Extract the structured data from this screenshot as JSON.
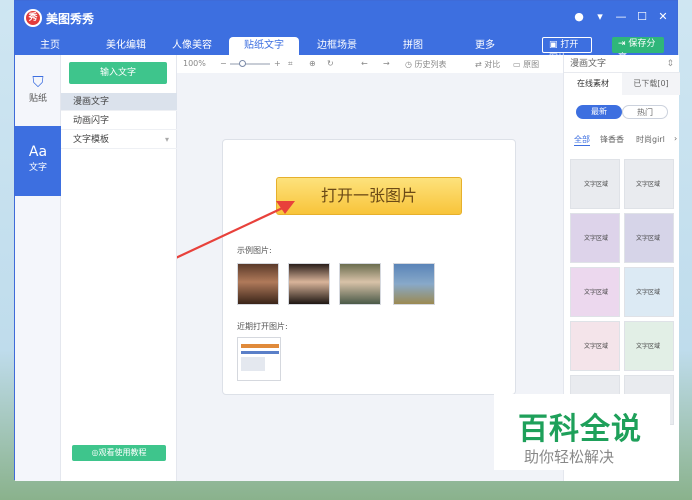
{
  "window": {
    "title": "美图秀秀",
    "logo_char": "秀",
    "controls": [
      "●",
      "▾",
      "—",
      "☐",
      "✕"
    ]
  },
  "nav": {
    "tabs": [
      "主页",
      "美化编辑",
      "人像美容",
      "贴纸文字",
      "边框场景",
      "拼图",
      "更多"
    ],
    "active_tab": "贴纸文字",
    "open_image_label": "打开图片",
    "save_share_label": "保存分享"
  },
  "iconbar": {
    "items": [
      {
        "label": "贴纸",
        "icon": "bookmark-icon"
      },
      {
        "label": "文字",
        "icon": "text-aa-icon"
      }
    ],
    "active": "文字"
  },
  "panel2": {
    "input_text_button": "输入文字",
    "categories": [
      "漫画文字",
      "动画闪字",
      "文字模板"
    ],
    "active_category": "漫画文字",
    "tutorial_button": "◎观看使用教程"
  },
  "toolbar": {
    "zoom": "100%",
    "history_label": "历史列表",
    "compare_label": "对比",
    "original_label": "原图"
  },
  "canvas": {
    "open_image_button": "打开一张图片",
    "sample_label": "示例图片:",
    "recent_label": "近期打开图片:"
  },
  "right_panel": {
    "header": "漫画文字",
    "tabs": [
      "在线素材",
      "已下载[0]"
    ],
    "active_tab": "在线素材",
    "pills": [
      "最新",
      "热门"
    ],
    "active_pill": "最新",
    "filters": [
      "全部",
      "锋香香",
      "时尚girl"
    ],
    "active_filter": "全部",
    "sticker_text": "文字区域"
  },
  "watermark": {
    "title": "百科全说",
    "subtitle": "助你轻松解决"
  },
  "colors": {
    "brand_blue": "#3d6fe0",
    "green": "#3ec58c",
    "yellow_button": "#f8c43a",
    "arrow_red": "#e8413b"
  }
}
